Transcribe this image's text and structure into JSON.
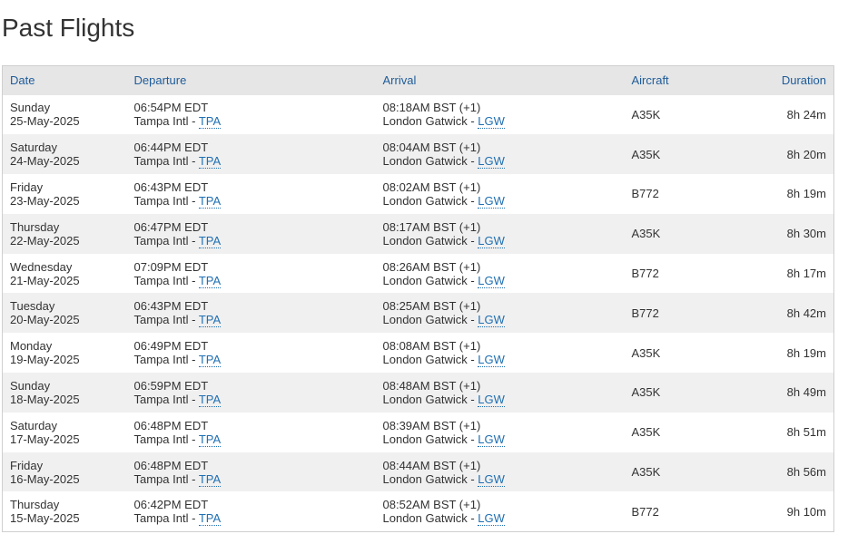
{
  "page": {
    "title": "Past Flights"
  },
  "table": {
    "headers": {
      "date": "Date",
      "departure": "Departure",
      "arrival": "Arrival",
      "aircraft": "Aircraft",
      "duration": "Duration"
    },
    "separator": " - ",
    "rows": [
      {
        "day": "Sunday",
        "date": "25-May-2025",
        "dep_time": "06:54PM EDT",
        "dep_airport": "Tampa Intl",
        "dep_code": "TPA",
        "arr_time": "08:18AM BST (+1)",
        "arr_airport": "London Gatwick",
        "arr_code": "LGW",
        "aircraft": "A35K",
        "duration": "8h 24m"
      },
      {
        "day": "Saturday",
        "date": "24-May-2025",
        "dep_time": "06:44PM EDT",
        "dep_airport": "Tampa Intl",
        "dep_code": "TPA",
        "arr_time": "08:04AM BST (+1)",
        "arr_airport": "London Gatwick",
        "arr_code": "LGW",
        "aircraft": "A35K",
        "duration": "8h 20m"
      },
      {
        "day": "Friday",
        "date": "23-May-2025",
        "dep_time": "06:43PM EDT",
        "dep_airport": "Tampa Intl",
        "dep_code": "TPA",
        "arr_time": "08:02AM BST (+1)",
        "arr_airport": "London Gatwick",
        "arr_code": "LGW",
        "aircraft": "B772",
        "duration": "8h 19m"
      },
      {
        "day": "Thursday",
        "date": "22-May-2025",
        "dep_time": "06:47PM EDT",
        "dep_airport": "Tampa Intl",
        "dep_code": "TPA",
        "arr_time": "08:17AM BST (+1)",
        "arr_airport": "London Gatwick",
        "arr_code": "LGW",
        "aircraft": "A35K",
        "duration": "8h 30m"
      },
      {
        "day": "Wednesday",
        "date": "21-May-2025",
        "dep_time": "07:09PM EDT",
        "dep_airport": "Tampa Intl",
        "dep_code": "TPA",
        "arr_time": "08:26AM BST (+1)",
        "arr_airport": "London Gatwick",
        "arr_code": "LGW",
        "aircraft": "B772",
        "duration": "8h 17m"
      },
      {
        "day": "Tuesday",
        "date": "20-May-2025",
        "dep_time": "06:43PM EDT",
        "dep_airport": "Tampa Intl",
        "dep_code": "TPA",
        "arr_time": "08:25AM BST (+1)",
        "arr_airport": "London Gatwick",
        "arr_code": "LGW",
        "aircraft": "B772",
        "duration": "8h 42m"
      },
      {
        "day": "Monday",
        "date": "19-May-2025",
        "dep_time": "06:49PM EDT",
        "dep_airport": "Tampa Intl",
        "dep_code": "TPA",
        "arr_time": "08:08AM BST (+1)",
        "arr_airport": "London Gatwick",
        "arr_code": "LGW",
        "aircraft": "A35K",
        "duration": "8h 19m"
      },
      {
        "day": "Sunday",
        "date": "18-May-2025",
        "dep_time": "06:59PM EDT",
        "dep_airport": "Tampa Intl",
        "dep_code": "TPA",
        "arr_time": "08:48AM BST (+1)",
        "arr_airport": "London Gatwick",
        "arr_code": "LGW",
        "aircraft": "A35K",
        "duration": "8h 49m"
      },
      {
        "day": "Saturday",
        "date": "17-May-2025",
        "dep_time": "06:48PM EDT",
        "dep_airport": "Tampa Intl",
        "dep_code": "TPA",
        "arr_time": "08:39AM BST (+1)",
        "arr_airport": "London Gatwick",
        "arr_code": "LGW",
        "aircraft": "A35K",
        "duration": "8h 51m"
      },
      {
        "day": "Friday",
        "date": "16-May-2025",
        "dep_time": "06:48PM EDT",
        "dep_airport": "Tampa Intl",
        "dep_code": "TPA",
        "arr_time": "08:44AM BST (+1)",
        "arr_airport": "London Gatwick",
        "arr_code": "LGW",
        "aircraft": "A35K",
        "duration": "8h 56m"
      },
      {
        "day": "Thursday",
        "date": "15-May-2025",
        "dep_time": "06:42PM EDT",
        "dep_airport": "Tampa Intl",
        "dep_code": "TPA",
        "arr_time": "08:52AM BST (+1)",
        "arr_airport": "London Gatwick",
        "arr_code": "LGW",
        "aircraft": "B772",
        "duration": "9h 10m"
      }
    ]
  },
  "colors": {
    "link": "#1f6fb2",
    "header_text": "#1f5c99",
    "header_bg": "#e6e6e6",
    "stripe_bg": "#f0f0f0"
  }
}
